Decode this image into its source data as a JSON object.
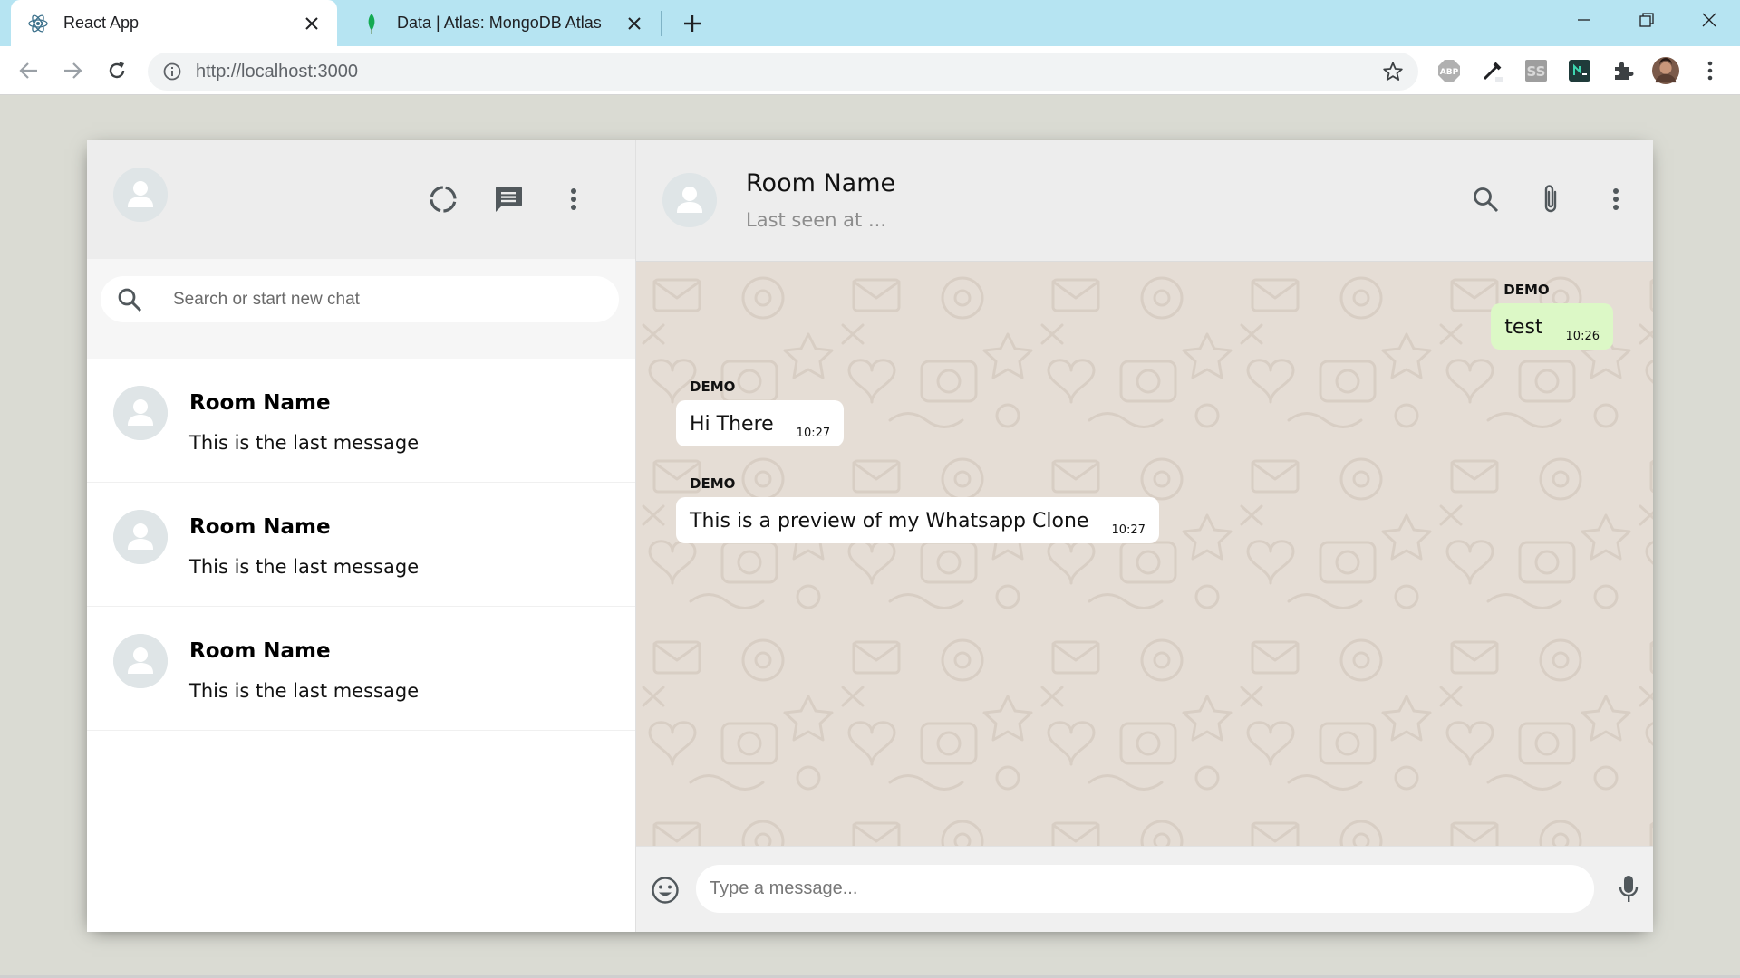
{
  "browser": {
    "tabs": [
      {
        "title": "React App",
        "icon": "react-logo-icon",
        "active": true
      },
      {
        "title": "Data | Atlas: MongoDB Atlas",
        "icon": "mongodb-leaf-icon",
        "active": false
      }
    ],
    "url": "http://localhost:3000",
    "extensions": [
      "adblock-plus-icon",
      "eyedropper-icon",
      "ss-extension-icon",
      "terminal-extension-icon",
      "puzzle-extensions-icon",
      "profile-avatar-icon"
    ],
    "colors": {
      "tabstrip": "#b6e4f2",
      "toolbar": "#ffffff"
    }
  },
  "sidebar": {
    "header_icons": [
      "status-icon",
      "new-chat-icon",
      "more-vert-icon"
    ],
    "search": {
      "placeholder": "Search or start new chat"
    },
    "chats": [
      {
        "name": "Room Name",
        "last_message": "This is the last message"
      },
      {
        "name": "Room Name",
        "last_message": "This is the last message"
      },
      {
        "name": "Room Name",
        "last_message": "This is the last message"
      }
    ]
  },
  "chat": {
    "header": {
      "name": "Room Name",
      "last_seen": "Last seen at ...",
      "icons": [
        "search-icon",
        "attach-icon",
        "more-vert-icon"
      ]
    },
    "messages": [
      {
        "sender": "DEMO",
        "text": "test",
        "time": "10:26",
        "type": "sent"
      },
      {
        "sender": "DEMO",
        "text": "Hi There",
        "time": "10:27",
        "type": "received"
      },
      {
        "sender": "DEMO",
        "text": "This is a preview of my Whatsapp Clone",
        "time": "10:27",
        "type": "received"
      }
    ],
    "footer": {
      "placeholder": "Type a message..."
    },
    "colors": {
      "sent_bubble": "#dcf8c6",
      "received_bubble": "#ffffff",
      "background": "#e5ddd5"
    }
  }
}
